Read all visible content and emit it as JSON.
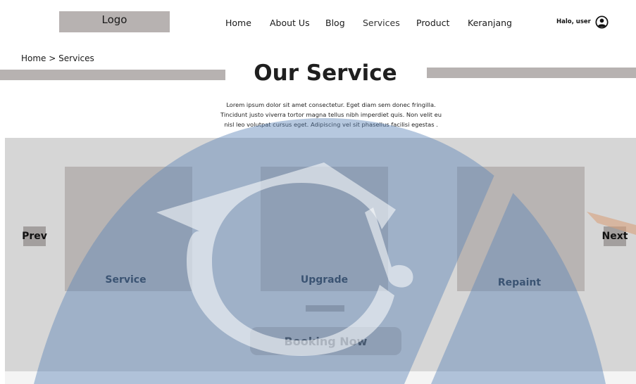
{
  "header": {
    "logo": "Logo",
    "nav": [
      "Home",
      "About Us",
      "Blog",
      "Services",
      "Product",
      "Keranjang"
    ],
    "greeting": "Halo, user",
    "user_icon": "user-circle-icon"
  },
  "breadcrumb": {
    "home": "Home",
    "separator": ">",
    "current": "Services"
  },
  "page": {
    "title": "Our Service",
    "intro_lines": [
      "Lorem ipsum dolor sit amet consectetur. Eget diam sem donec fringilla.",
      "Tincidunt justo viverra tortor magna tellus nibh imperdiet quis. Non velit eu",
      "nisl leo volutpat cursus eget. Adipiscing vel sit phasellus facilisi egestas ."
    ]
  },
  "carousel": {
    "prev": "Prev",
    "next": "Next",
    "cards": [
      "Service",
      "Upgrade",
      "Repaint"
    ],
    "button": "Booking Now"
  },
  "colors": {
    "placeholder": "#b7b2b1",
    "band": "#d6d6d6",
    "watermark": "#5d86b8"
  }
}
